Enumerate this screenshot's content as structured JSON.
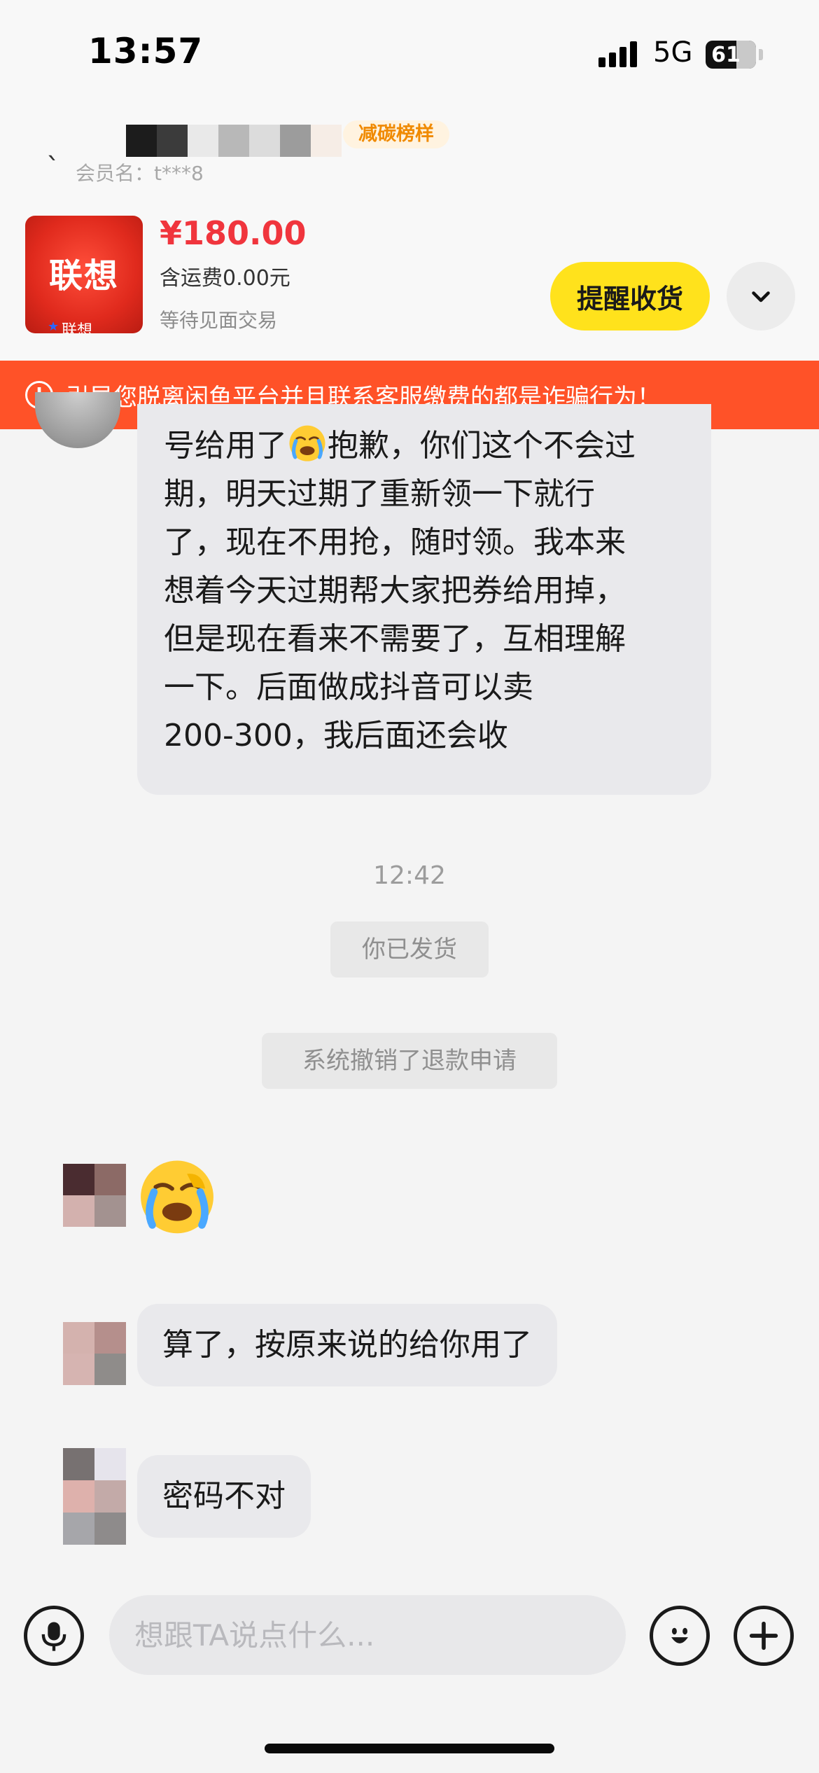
{
  "status_bar": {
    "time": "13:57",
    "network": "5G",
    "battery": "61",
    "signal_bars": 4
  },
  "header": {
    "seller_badge": "减碳榜样",
    "member_name": "会员名：t***8"
  },
  "product": {
    "thumb_logo": "联想",
    "thumb_sub": "联想",
    "price": "¥180.00",
    "shipping": "含运费0.00元",
    "status": "等待见面交易",
    "remind_label": "提醒收货"
  },
  "warning": {
    "icon": "!",
    "text": "引导您脱离闲鱼平台并且联系客服缴费的都是诈骗行为！"
  },
  "messages": {
    "long_text_part1": "号给用了",
    "long_text_part2": "抱歉，你们这个不会过\n期，明天过期了重新领一下就行\n了，现在不用抢，随时领。我本来\n想着今天过期帮大家把券给用掉，\n但是现在看来不需要了，互相理解\n一下。后面做成抖音可以卖\n200-300，我后面还会收",
    "time_label": "12:42",
    "system_shipped": "你已发货",
    "system_refund": "系统撤销了退款申请",
    "msg_2": "算了，按原来说的给你用了",
    "msg_3": "密码不对"
  },
  "input": {
    "placeholder": "想跟TA说点什么..."
  },
  "colors": {
    "accent_yellow": "#ffe21c",
    "price_red": "#f0353d",
    "warning_orange": "#ff5228",
    "badge_orange": "#f08a00"
  },
  "icons": [
    "back-icon",
    "chevron-down-icon",
    "warning-icon",
    "crying-emoji-icon",
    "microphone-icon",
    "emoji-icon",
    "plus-icon"
  ]
}
